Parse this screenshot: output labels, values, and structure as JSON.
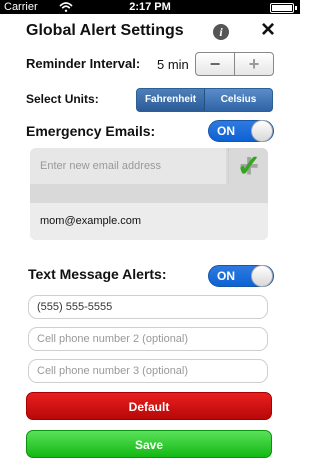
{
  "status_bar": {
    "carrier": "Carrier",
    "time": "2:17 PM"
  },
  "header": {
    "title": "Global Alert Settings"
  },
  "reminder": {
    "label": "Reminder Interval:",
    "value": "5 min",
    "minus": "−",
    "plus": "+"
  },
  "units": {
    "label": "Select Units:",
    "options": [
      "Fahrenheit",
      "Celsius"
    ]
  },
  "emergency": {
    "label": "Emergency Emails:",
    "toggle": "ON",
    "placeholder": "Enter new email address",
    "email": "mom@example.com"
  },
  "sms": {
    "label": "Text Message Alerts:",
    "toggle": "ON",
    "phone1": "(555) 555-5555",
    "phone2_placeholder": "Cell phone number 2 (optional)",
    "phone3_placeholder": "Cell phone number 3 (optional)"
  },
  "actions": {
    "default": "Default",
    "save": "Save"
  },
  "colors": {
    "accent": "#1f6fd8",
    "danger": "#d91818",
    "success": "#24c12a"
  }
}
